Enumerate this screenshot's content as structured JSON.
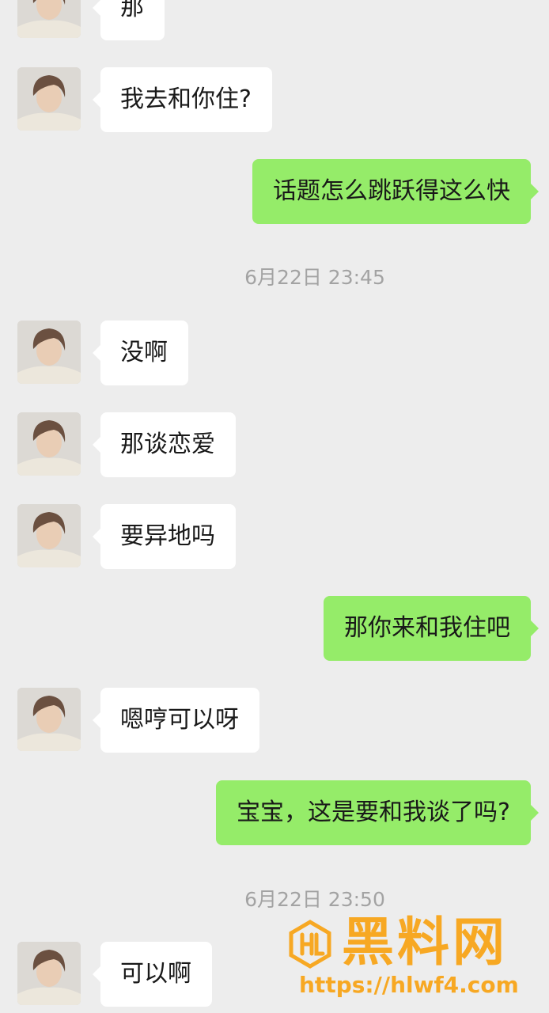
{
  "messages": [
    {
      "side": "left",
      "text": "那"
    },
    {
      "side": "left",
      "text": "我去和你住?"
    },
    {
      "side": "right",
      "text": "话题怎么跳跃得这么快"
    },
    {
      "side": "left",
      "text": "没啊"
    },
    {
      "side": "left",
      "text": "那谈恋爱"
    },
    {
      "side": "left",
      "text": "要异地吗"
    },
    {
      "side": "right",
      "text": "那你来和我住吧"
    },
    {
      "side": "left",
      "text": "嗯哼可以呀"
    },
    {
      "side": "right",
      "text": "宝宝，这是要和我谈了吗?"
    },
    {
      "side": "left",
      "text": "可以啊"
    }
  ],
  "timestamps": [
    "6月22日 23:45",
    "6月22日 23:50"
  ],
  "watermark": {
    "title": "黑料网",
    "url": "https://hlwf4.com",
    "color": "#f7a823"
  },
  "colors": {
    "background": "#ededed",
    "bubble_self": "#95ec69",
    "bubble_other": "#ffffff"
  },
  "icons": {
    "avatar": "contact-avatar-photo",
    "watermark_logo": "hl-logo-icon"
  }
}
